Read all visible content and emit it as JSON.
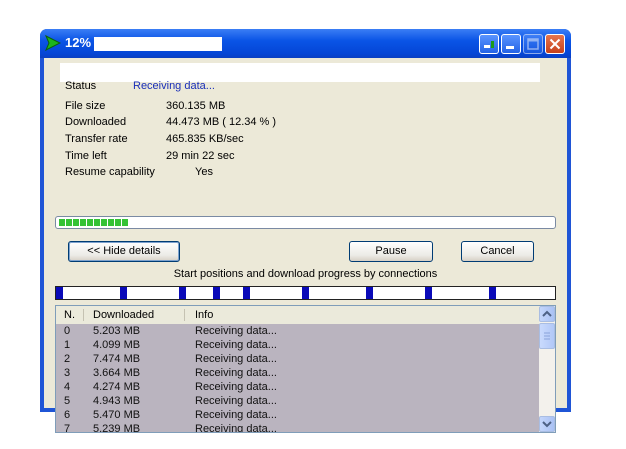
{
  "window": {
    "title": "12%",
    "buttons": [
      "minimize-to-tray",
      "minimize",
      "maximize",
      "close"
    ]
  },
  "icons": {
    "app": "green-play-arrow-icon"
  },
  "info": {
    "status_label": "Status",
    "status_value": "Receiving data...",
    "file_size_label": "File size",
    "file_size_value": "360.135  MB",
    "downloaded_label": "Downloaded",
    "downloaded_value": "44.473  MB  ( 12.34 % )",
    "transfer_rate_label": "Transfer rate",
    "transfer_rate_value": "465.835  KB/sec",
    "time_left_label": "Time left",
    "time_left_value": "29 min 22 sec",
    "resume_label": "Resume capability",
    "resume_value": "Yes"
  },
  "progress": {
    "percent": 12.34,
    "segments": 10
  },
  "buttons": {
    "hide_details": "<< Hide details",
    "pause": "Pause",
    "cancel": "Cancel"
  },
  "connections": {
    "caption": "Start positions and download progress by connections",
    "markers": [
      0.0,
      0.13,
      0.25,
      0.32,
      0.38,
      0.5,
      0.63,
      0.75,
      0.88
    ]
  },
  "list": {
    "headers": [
      "N.",
      "Downloaded",
      "Info"
    ],
    "rows": [
      [
        "0",
        "5.203  MB",
        "Receiving data..."
      ],
      [
        "1",
        "4.099  MB",
        "Receiving data..."
      ],
      [
        "2",
        "7.474  MB",
        "Receiving data..."
      ],
      [
        "3",
        "3.664  MB",
        "Receiving data..."
      ],
      [
        "4",
        "4.274  MB",
        "Receiving data..."
      ],
      [
        "5",
        "4.943  MB",
        "Receiving data..."
      ],
      [
        "6",
        "5.470  MB",
        "Receiving data..."
      ],
      [
        "7",
        "5.239  MB",
        "Receiving data..."
      ]
    ]
  },
  "colors": {
    "titlebar": "#0a54e6",
    "progress_fill": "#35c235",
    "connection_marker": "#0a0ab8",
    "row_background": "#bab4bf",
    "status_value": "#1a2fb8"
  }
}
